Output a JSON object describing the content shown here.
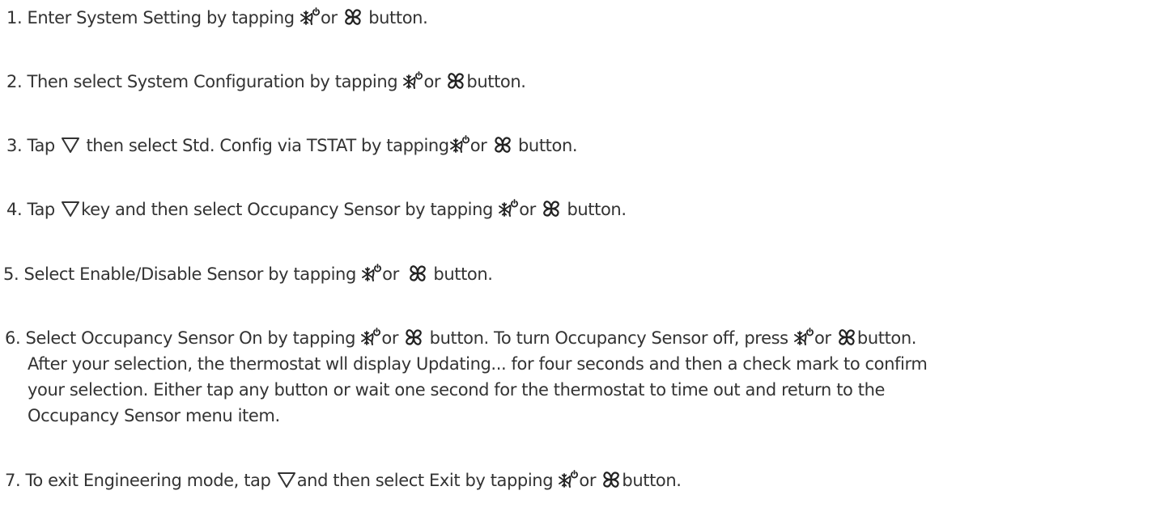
{
  "steps": [
    {
      "s1": "1. Enter System Setting by tapping",
      "s2": "or",
      "s3": "button."
    },
    {
      "s1": "2. Then select System Configuration by tapping",
      "s2": "or",
      "s3": "button."
    },
    {
      "s1": "3. Tap",
      "s2": "then select Std. Config via TSTAT by tapping",
      "s3": "or",
      "s4": "button."
    },
    {
      "s1": "4. Tap",
      "s2": "key and then select Occupancy Sensor by tapping",
      "s3": "or",
      "s4": "button."
    },
    {
      "s1": "5. Select Enable/Disable Sensor by tapping",
      "s2": "or",
      "s3": "button."
    },
    {
      "s1": "6. Select Occupancy Sensor On by tapping",
      "s2": "or",
      "s3": "button. To turn Occupancy Sensor off, press",
      "s4": "or",
      "s5": "button.",
      "cont": [
        "After your selection, the thermostat wll display Updating... for four seconds and then a check mark to confirm",
        "your selection. Either tap any button or wait one second for the thermostat to time out and return to the",
        "Occupancy Sensor menu item."
      ]
    },
    {
      "s1": "7. To exit Engineering mode, tap",
      "s2": "and then select Exit by tapping",
      "s3": "or",
      "s4": "button."
    }
  ],
  "icons": {
    "mode": "mode-snowflake-power-icon",
    "fan": "fan-icon",
    "down": "down-triangle-icon"
  }
}
